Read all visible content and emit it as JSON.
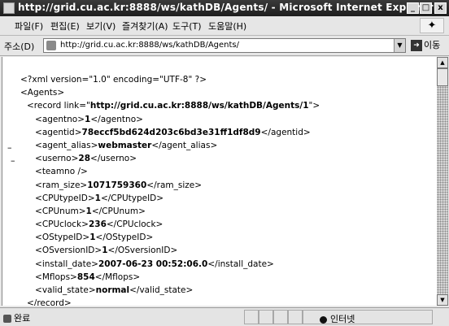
{
  "window": {
    "title": "http://grid.cu.ac.kr:8888/ws/kathDB/Agents/ - Microsoft Internet Explorer",
    "controls": {
      "minimize": "_",
      "maximize": "□",
      "close": "x"
    }
  },
  "menu": {
    "items": [
      "파일(F)",
      "편집(E)",
      "보기(V)",
      "즐겨찾기(A)",
      "도구(T)",
      "도움말(H)"
    ]
  },
  "address": {
    "label": "주소(D)",
    "url": "http://grid.cu.ac.kr:8888/ws/kathDB/Agents/",
    "go_label": "이동"
  },
  "xml": {
    "declaration": "<?xml version=\"1.0\" encoding=\"UTF-8\" ?>",
    "root_open": "<Agents>",
    "record_open_prefix": "<record link=\"",
    "record_link": "http://grid.cu.ac.kr:8888/ws/kathDB/Agents/1",
    "record_open_suffix": "\">",
    "fields": [
      {
        "name": "agentno",
        "value": "1"
      },
      {
        "name": "agentid",
        "value": "78eccf5bd624d203c6bd3e31ff1df8d9"
      },
      {
        "name": "agent_alias",
        "value": "webmaster"
      },
      {
        "name": "userno",
        "value": "28"
      },
      {
        "name": "teamno",
        "empty": true
      },
      {
        "name": "ram_size",
        "value": "1071759360"
      },
      {
        "name": "CPUtypeID",
        "value": "1"
      },
      {
        "name": "CPUnum",
        "value": "1"
      },
      {
        "name": "CPUclock",
        "value": "236"
      },
      {
        "name": "OStypeID",
        "value": "1"
      },
      {
        "name": "OSversionID",
        "value": "1"
      },
      {
        "name": "install_date",
        "value": "2007-06-23 00:52:06.0"
      },
      {
        "name": "Mflops",
        "value": "854"
      },
      {
        "name": "valid_state",
        "value": "normal"
      }
    ],
    "record_close": "</record>"
  },
  "status": {
    "text": "완료",
    "zone": "인터넷"
  }
}
